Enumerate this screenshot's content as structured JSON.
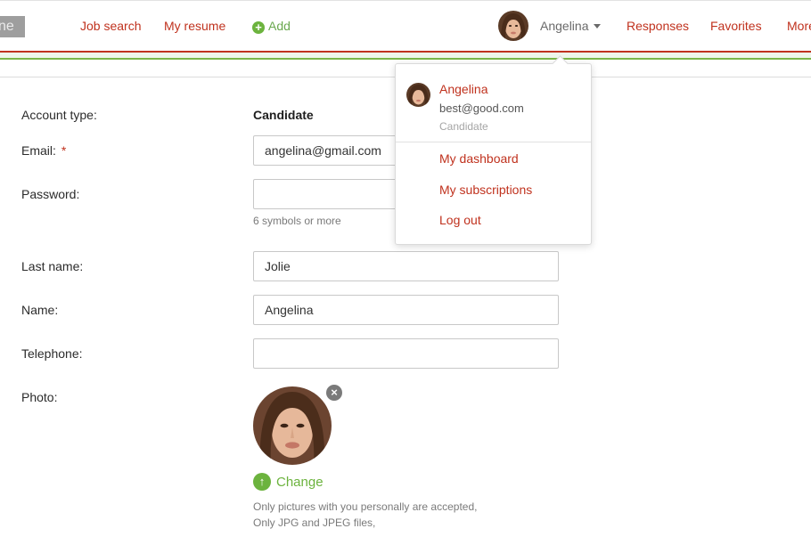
{
  "header": {
    "logo_fragment": "ne",
    "nav": {
      "job_search": "Job search",
      "my_resume": "My resume",
      "add": "Add",
      "responses": "Responses",
      "favorites": "Favorites",
      "more": "More"
    },
    "user_name": "Angelina",
    "icons": {
      "add": "plus-circle-icon",
      "caret": "caret-down-icon"
    }
  },
  "dropdown": {
    "name": "Angelina",
    "email": "best@good.com",
    "role": "Candidate",
    "items": [
      "My dashboard",
      "My subscriptions",
      "Log out"
    ]
  },
  "form": {
    "account_type_label": "Account type:",
    "account_type_value": "Candidate",
    "email_label": "Email:",
    "required_mark": "*",
    "email_value": "angelina@gmail.com",
    "password_label": "Password:",
    "password_value": "",
    "password_hint": "6 symbols or more",
    "last_name_label": "Last name:",
    "last_name_value": "Jolie",
    "name_label": "Name:",
    "name_value": "Angelina",
    "telephone_label": "Telephone:",
    "telephone_value": "",
    "photo_label": "Photo:",
    "remove_icon": "close-circle-icon",
    "change_label": "Change",
    "change_icon": "upload-arrow-icon",
    "photo_note_1": "Only pictures with you personally are accepted,",
    "photo_note_2": "Only JPG and JPEG files,"
  },
  "colors": {
    "accent_red": "#c0321e",
    "accent_green": "#6cb33e",
    "muted_text": "#7a7a7a"
  }
}
